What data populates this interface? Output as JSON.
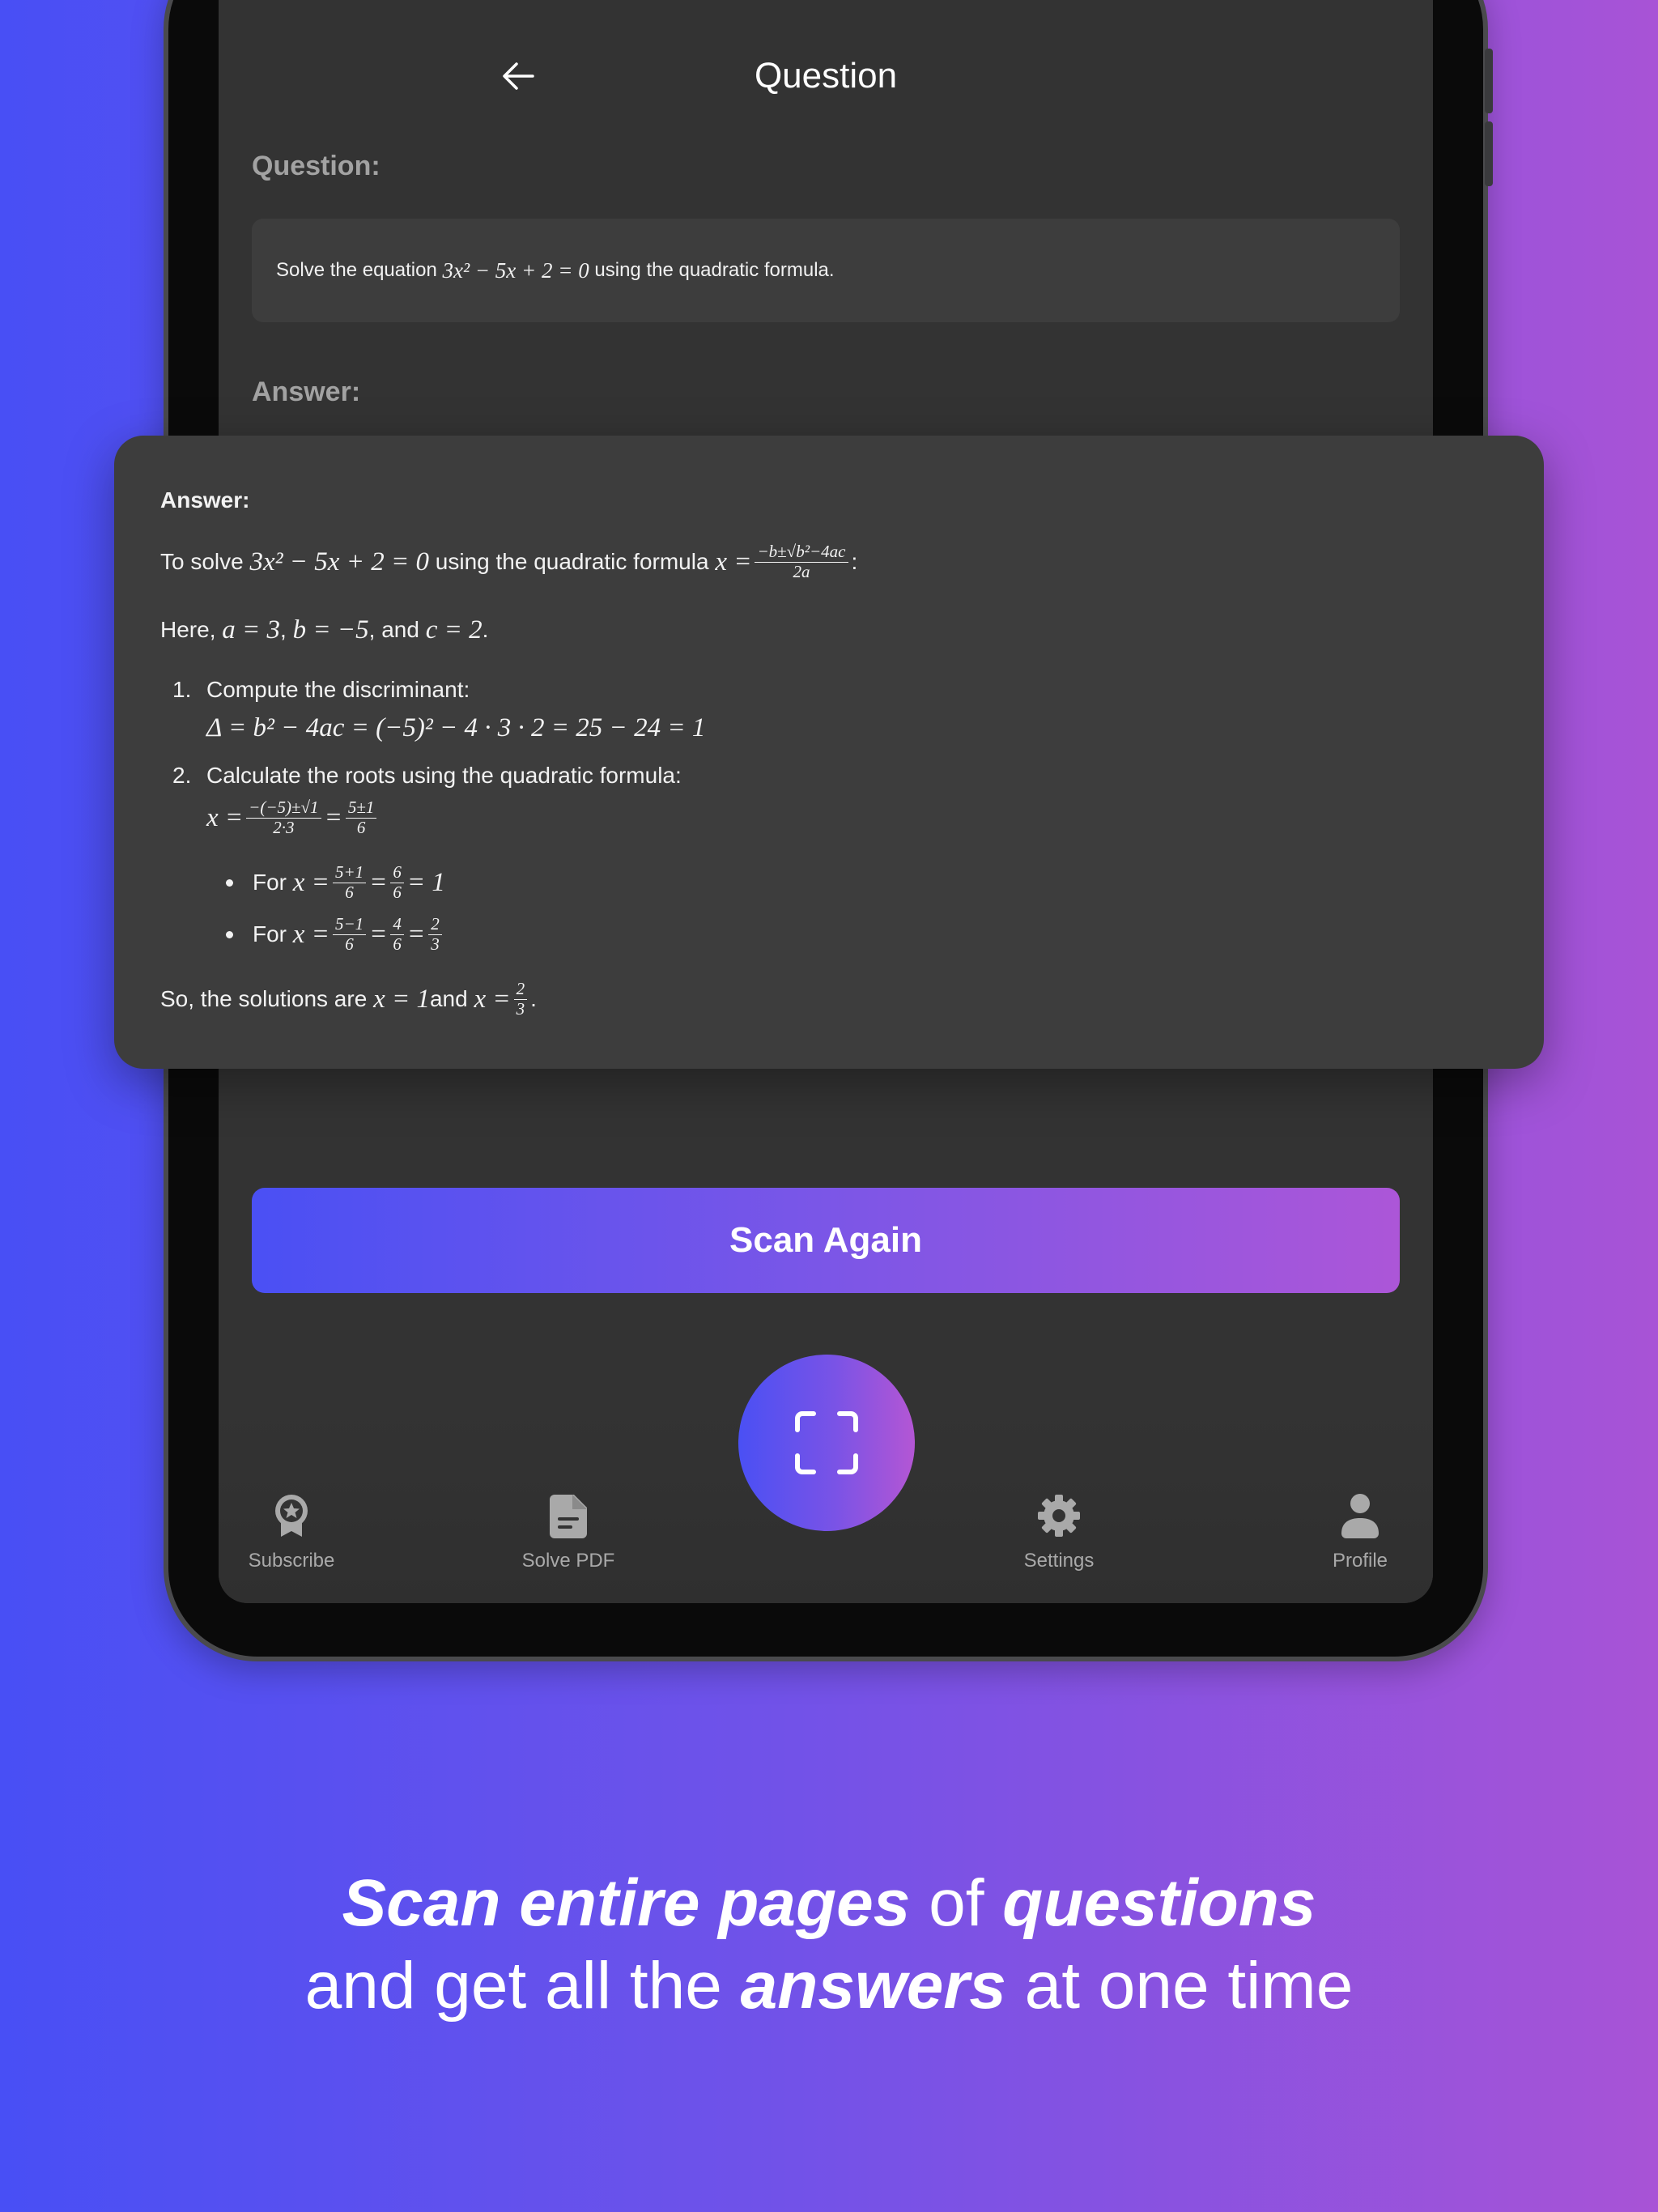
{
  "header": {
    "title": "Question",
    "back_icon": "arrow-left-icon"
  },
  "question": {
    "label": "Question:",
    "text_prefix": "Solve the equation ",
    "equation": "3x² − 5x + 2 = 0",
    "text_suffix": " using the quadratic formula."
  },
  "answer_label": "Answer:",
  "answer_card": {
    "title": "Answer:",
    "intro_prefix": "To solve ",
    "intro_equation": "3x² − 5x + 2 = 0",
    "intro_middle": " using the quadratic formula ",
    "formula_lhs": "x =",
    "formula_num": "−b±√b²−4ac",
    "formula_den": "2a",
    "intro_suffix": ":",
    "here_prefix": "Here, ",
    "here_a": "a = 3",
    "here_b": "b = −5",
    "here_and": ", and ",
    "here_c": "c = 2",
    "here_suffix": ".",
    "steps": [
      {
        "number": "1.",
        "text": "Compute the discriminant:",
        "math": "Δ = b² − 4ac = (−5)² − 4 · 3 · 2 = 25 − 24 = 1"
      },
      {
        "number": "2.",
        "text": "Calculate the roots using the quadratic formula:",
        "math_lhs": "x =",
        "frac1_num": "−(−5)±√1",
        "frac1_den": "2·3",
        "eq": "=",
        "frac2_num": "5±1",
        "frac2_den": "6"
      }
    ],
    "bullets": [
      {
        "prefix": "For ",
        "lhs": "x =",
        "f1n": "5+1",
        "f1d": "6",
        "f2n": "6",
        "f2d": "6",
        "result": "= 1"
      },
      {
        "prefix": "For ",
        "lhs": "x =",
        "f1n": "5−1",
        "f1d": "6",
        "f2n": "4",
        "f2d": "6",
        "f3n": "2",
        "f3d": "3"
      }
    ],
    "conclusion_prefix": "So, the solutions are ",
    "conclusion_x1": "x = 1",
    "conclusion_and": " and ",
    "conclusion_x2": "x =",
    "conclusion_num": "2",
    "conclusion_den": "3",
    "conclusion_suffix": "."
  },
  "scan_again_label": "Scan Again",
  "nav": {
    "items": [
      {
        "label": "Subscribe",
        "icon": "badge-star-icon"
      },
      {
        "label": "Solve PDF",
        "icon": "document-icon"
      },
      {
        "label": "Settings",
        "icon": "gear-icon"
      },
      {
        "label": "Profile",
        "icon": "person-icon"
      }
    ],
    "fab_icon": "scan-frame-icon"
  },
  "tagline": {
    "line1_a": "Scan entire pages",
    "line1_b": " of ",
    "line1_c": "questions",
    "line2_a": "and get all the ",
    "line2_b": "answers",
    "line2_c": " at one time"
  },
  "colors": {
    "gradient_start": "#484ff5",
    "gradient_end": "#a853d6",
    "screen_bg": "#333333",
    "card_bg": "#3d3d3d"
  }
}
